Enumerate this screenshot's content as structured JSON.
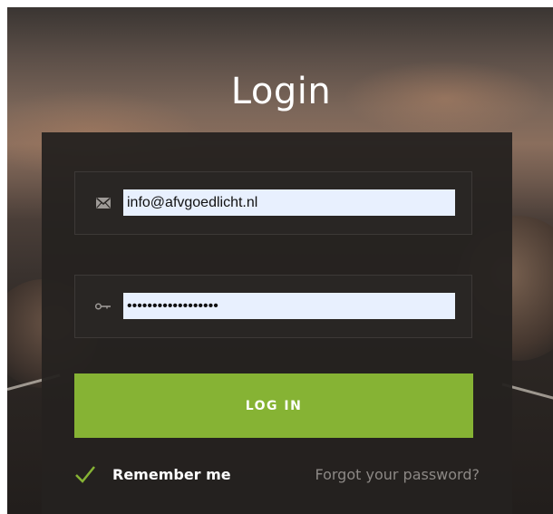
{
  "page": {
    "title": "Login"
  },
  "form": {
    "email": {
      "value": "info@afvgoedlicht.nl",
      "icon": "envelope-icon"
    },
    "password": {
      "value": "••••••••••••••••••",
      "icon": "key-icon"
    },
    "login_button_label": "LOG IN",
    "remember_me": {
      "label": "Remember me",
      "checked": true,
      "icon": "checkmark-icon"
    },
    "forgot_password_label": "Forgot your password?"
  },
  "colors": {
    "accent_green": "#86b334",
    "panel_bg": "#252220",
    "autofill_bg": "#e8f0fe"
  }
}
